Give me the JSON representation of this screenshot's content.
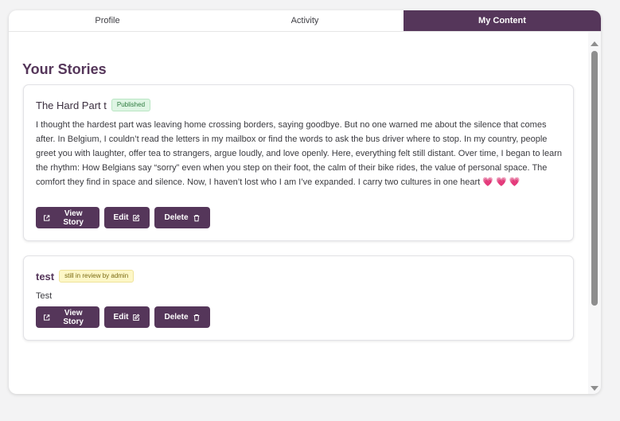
{
  "tabs": {
    "profile": "Profile",
    "activity": "Activity",
    "my_content": "My Content"
  },
  "main": {
    "section_title": "Your Stories"
  },
  "stories": [
    {
      "title": "The Hard Part t",
      "status": "Published",
      "text": "I thought the hardest part was leaving home crossing borders, saying goodbye. But no one warned me about the silence that comes after. In Belgium, I couldn’t read the letters in my mailbox or find the words to ask the bus driver where to stop. In my country, people greet you with laughter, offer tea to strangers, argue loudly, and love openly. Here, everything felt still distant. Over time, I began to learn the rhythm: How Belgians say “sorry” even when you step on their foot, the calm of their bike rides, the value of personal space. The comfort they find in space and silence. Now, I haven’t lost who I am I’ve expanded. I carry two cultures in one heart 💗 💗 💗"
    },
    {
      "title": "test",
      "status": "still in review by admin",
      "text": "Test"
    }
  ],
  "actions": {
    "view_label": "View Story",
    "edit_label": "Edit",
    "delete_label": "Delete"
  },
  "colors": {
    "brand": "#55365a",
    "published_badge": "#dff5e4",
    "review_badge": "#fdf7c7"
  }
}
